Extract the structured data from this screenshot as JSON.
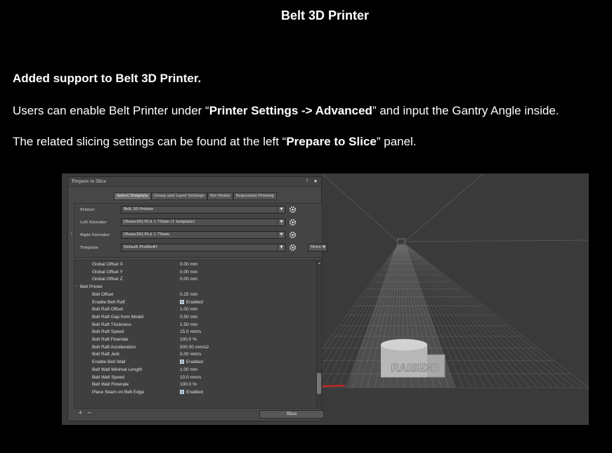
{
  "page": {
    "title": "Belt 3D Printer",
    "p1": "Added support to Belt 3D Printer.",
    "p2": {
      "before": "Users can enable Belt Printer under “",
      "bold": "Printer Settings -> Advanced",
      "after": "” and input the Gantry Angle inside."
    },
    "p3": {
      "before": "The related slicing settings can be found at the left “",
      "bold": "Prepare to Slice",
      "after": "” panel."
    }
  },
  "panel": {
    "title": "Prepare to Slice",
    "help": "?",
    "close": "✖",
    "tabs": [
      {
        "label": "Select Template",
        "active": true
      },
      {
        "label": "Group and Layer Settings",
        "active": false
      },
      {
        "label": "Per-Model",
        "active": false
      },
      {
        "label": "Sequential Printing",
        "active": false
      }
    ],
    "settings": [
      {
        "label": "Printer:",
        "value": "Belt 3D Printer"
      },
      {
        "label": "Left Extruder",
        "value": "[Raise3D] PLA 1.75mm (1 template)"
      },
      {
        "label": "Right Extruder",
        "value": "[Raise3D] PLA 1.75mm"
      },
      {
        "label": "Template",
        "value": "Default Profile#1"
      }
    ],
    "more_label": "More",
    "tree": [
      {
        "label": "Global Offset X",
        "value": "0.00 mm",
        "level": 2
      },
      {
        "label": "Global Offset Y",
        "value": "0.00 mm",
        "level": 2
      },
      {
        "label": "Global Offset Z",
        "value": "0.00 mm",
        "level": 2
      },
      {
        "label": "Belt Printer",
        "value": "",
        "level": 1,
        "group": true
      },
      {
        "label": "Belt Offset",
        "value": "0.25 mm",
        "level": 2
      },
      {
        "label": "Enable Belt Raft",
        "value": "Enabled",
        "level": 2,
        "checkbox": true
      },
      {
        "label": "Belt Raft Offset",
        "value": "1.00 mm",
        "level": 2
      },
      {
        "label": "Belt Raft Gap from Model",
        "value": "0.50 mm",
        "level": 2
      },
      {
        "label": "Belt Raft Thickness",
        "value": "1.50 mm",
        "level": 2
      },
      {
        "label": "Belt Raft Speed",
        "value": "15.0 mm/s",
        "level": 2
      },
      {
        "label": "Belt Raft Flowrate",
        "value": "100.0 %",
        "level": 2
      },
      {
        "label": "Belt Raft Acceleration",
        "value": "500.00 mm/s2",
        "level": 2
      },
      {
        "label": "Belt Raft Jerk",
        "value": "5.00 mm/s",
        "level": 2
      },
      {
        "label": "Enable Belt Wall",
        "value": "Enabled",
        "level": 2,
        "checkbox": true
      },
      {
        "label": "Belt Wall Minimal Length",
        "value": "1.00 mm",
        "level": 2
      },
      {
        "label": "Belt Wall Speed",
        "value": "10.0 mm/s",
        "level": 2
      },
      {
        "label": "Belt Wall Flowrate",
        "value": "100.0 %",
        "level": 2
      },
      {
        "label": "Place Seam on Belt Edge",
        "value": "Enabled",
        "level": 2,
        "checkbox": true
      }
    ],
    "add_label": "+",
    "remove_label": "−",
    "slice_label": "Slice"
  },
  "viewport": {
    "model_text": "RAISE3D",
    "colors": {
      "background": "#3a3a3a",
      "grid": "#5a5a5a",
      "model": "#bdbdbd",
      "axis": "#e02020"
    }
  }
}
